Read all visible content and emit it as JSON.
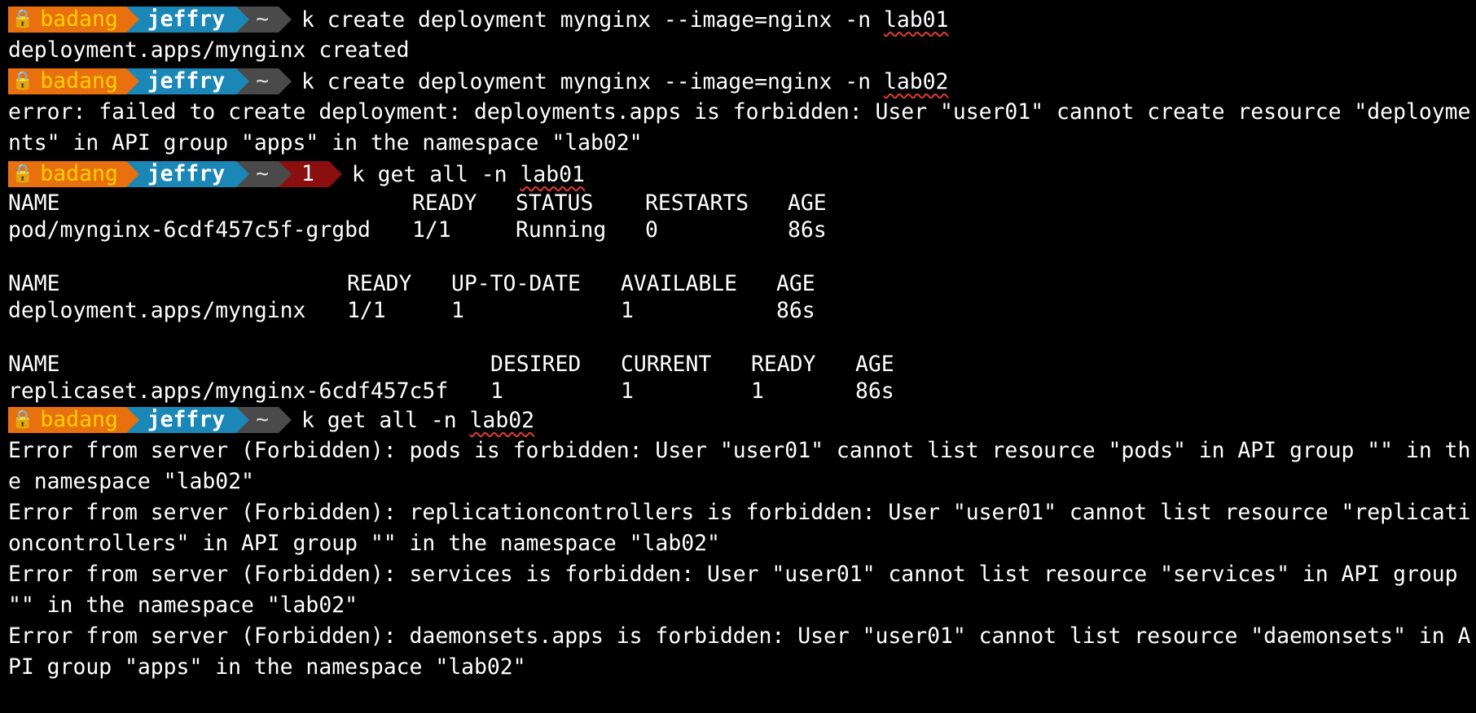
{
  "prompt": {
    "lock_icon": "lock-icon",
    "host": "badang",
    "user": "jeffry",
    "dir": "~",
    "error_code": "1",
    "colors": {
      "host_bg": "#e8700e",
      "host_fg": "#ffd000",
      "user_bg": "#1b87b6",
      "dir_bg": "#4a4a4a",
      "error_bg": "#8b0f0f",
      "underline": "#e23b2e"
    }
  },
  "commands": [
    {
      "text_before": "k create deployment mynginx --image=nginx -n ",
      "ns": "lab01"
    },
    {
      "text_before": "k create deployment mynginx --image=nginx -n ",
      "ns": "lab02"
    },
    {
      "text_before": "k get all -n ",
      "ns": "lab01"
    },
    {
      "text_before": "k get all -n ",
      "ns": "lab02"
    }
  ],
  "outputs": {
    "create1": "deployment.apps/mynginx created",
    "create2_line1": "error: failed to create deployment: deployments.apps is forbidden: User \"user01\" cannot create resource \"deployme",
    "create2_line2": "nts\" in API group \"apps\" in the namespace \"lab02\"",
    "pods_table": {
      "headers": [
        "NAME",
        "READY",
        "STATUS",
        "RESTARTS",
        "AGE"
      ],
      "rows": [
        [
          "pod/mynginx-6cdf457c5f-grgbd",
          "1/1",
          "Running",
          "0",
          "86s"
        ]
      ]
    },
    "deploy_table": {
      "headers": [
        "NAME",
        "READY",
        "UP-TO-DATE",
        "AVAILABLE",
        "AGE"
      ],
      "rows": [
        [
          "deployment.apps/mynginx",
          "1/1",
          "1",
          "1",
          "86s"
        ]
      ]
    },
    "rs_table": {
      "headers": [
        "NAME",
        "DESIRED",
        "CURRENT",
        "READY",
        "AGE"
      ],
      "rows": [
        [
          "replicaset.apps/mynginx-6cdf457c5f",
          "1",
          "1",
          "1",
          "86s"
        ]
      ]
    },
    "errors": [
      "Error from server (Forbidden): pods is forbidden: User \"user01\" cannot list resource \"pods\" in API group \"\" in th",
      "e namespace \"lab02\"",
      "Error from server (Forbidden): replicationcontrollers is forbidden: User \"user01\" cannot list resource \"replicati",
      "oncontrollers\" in API group \"\" in the namespace \"lab02\"",
      "Error from server (Forbidden): services is forbidden: User \"user01\" cannot list resource \"services\" in API group ",
      "\"\" in the namespace \"lab02\"",
      "Error from server (Forbidden): daemonsets.apps is forbidden: User \"user01\" cannot list resource \"daemonsets\" in A",
      "PI group \"apps\" in the namespace \"lab02\""
    ]
  }
}
